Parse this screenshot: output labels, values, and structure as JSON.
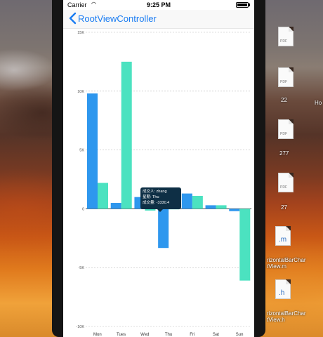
{
  "status_bar": {
    "carrier": "Carrier",
    "time": "9:25 PM"
  },
  "nav": {
    "back_label": "RootViewController"
  },
  "tooltip": {
    "line1": "成交人: zhang",
    "line2": "星期: Thu",
    "line3": "成交量: -3330.4"
  },
  "desktop_icons": [
    {
      "ext": "PDF",
      "label": ""
    },
    {
      "ext": "PDF",
      "label": "22"
    },
    {
      "ext": "PDF",
      "label": "277"
    },
    {
      "ext": "PDF",
      "label": "27"
    },
    {
      "ext": ".m",
      "label": "rizontalBarChar\ntView.m"
    },
    {
      "ext": ".h",
      "label": "rizontalBarChar\ntView.h"
    }
  ],
  "desktop_side_label": "Ho",
  "colors": {
    "series_a": "#2e97ee",
    "series_b": "#4be2c0",
    "accent": "#1a7cf2",
    "tooltip_bg": "#0e2f45"
  },
  "chart_data": {
    "type": "bar",
    "categories": [
      "Mon",
      "Tues",
      "Wed",
      "Thu",
      "Fri",
      "Sat",
      "Sun"
    ],
    "series": [
      {
        "values": [
          9800,
          500,
          1000,
          -3330.4,
          1300,
          300,
          -200
        ]
      },
      {
        "values": [
          2200,
          12500,
          -150,
          0,
          1100,
          300,
          -6100
        ]
      }
    ],
    "ylim": [
      -10000,
      15000
    ],
    "yticks": [
      -10000,
      -5000,
      0,
      5000,
      10000,
      15000
    ],
    "ytick_labels": [
      "-10K",
      "-5K",
      "0",
      "5K",
      "10K",
      "15K"
    ],
    "grid": true,
    "legend": "none"
  }
}
